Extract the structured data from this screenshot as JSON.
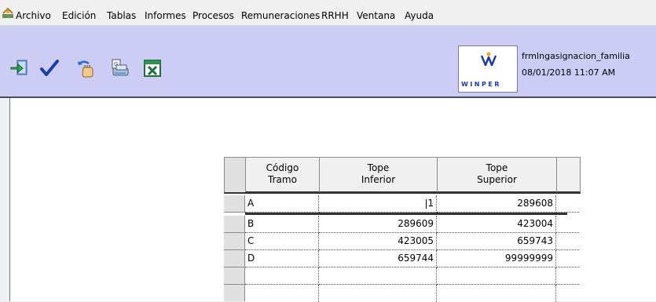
{
  "menu": {
    "items": [
      "Archivo",
      "Edición",
      "Tablas",
      "Informes",
      "Procesos",
      "Remuneraciones",
      "RRHH",
      "Ventana",
      "Ayuda"
    ]
  },
  "toolbar": {
    "buttons": [
      "exit-icon",
      "check-icon",
      "undo-icon",
      "print-icon",
      "excel-icon"
    ]
  },
  "logo": {
    "text": "WINPER"
  },
  "form": {
    "name": "frmIngasignacion_familia",
    "datetime": "08/01/2018 11:07 AM"
  },
  "grid": {
    "headers": [
      {
        "line1": "Código",
        "line2": "Tramo"
      },
      {
        "line1": "Tope",
        "line2": "Inferior"
      },
      {
        "line1": "Tope",
        "line2": "Superior"
      }
    ],
    "rows": [
      {
        "codigo": "A",
        "inferior": "1",
        "superior": "289608"
      },
      {
        "codigo": "B",
        "inferior": "289609",
        "superior": "423004"
      },
      {
        "codigo": "C",
        "inferior": "423005",
        "superior": "659743"
      },
      {
        "codigo": "D",
        "inferior": "659744",
        "superior": "99999999"
      },
      {
        "codigo": "",
        "inferior": "",
        "superior": ""
      }
    ]
  }
}
